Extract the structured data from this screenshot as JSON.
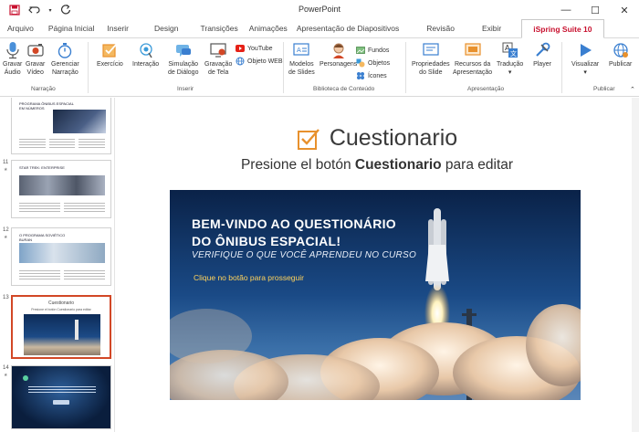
{
  "app": {
    "title": "PowerPoint"
  },
  "window_controls": [
    "—",
    "☐",
    "✕"
  ],
  "tabs": [
    {
      "label": "Arquivo",
      "active": false
    },
    {
      "label": "Página Inicial",
      "active": false
    },
    {
      "label": "Inserir",
      "active": false
    },
    {
      "label": "Design",
      "active": false
    },
    {
      "label": "Transições",
      "active": false
    },
    {
      "label": "Animações",
      "active": false
    },
    {
      "label": "Apresentação de Diapositivos",
      "active": false
    },
    {
      "label": "Revisão",
      "active": false
    },
    {
      "label": "Exibir",
      "active": false
    },
    {
      "label": "iSpring Suite 10",
      "active": true
    }
  ],
  "ribbon": {
    "narration": {
      "group_label": "Narração",
      "buttons": [
        {
          "line1": "Gravar",
          "line2": "Áudio",
          "icon": "microphone-icon"
        },
        {
          "line1": "Gravar",
          "line2": "Vídeo",
          "icon": "camera-icon"
        },
        {
          "line1": "Gerenciar",
          "line2": "Narração",
          "icon": "stopwatch-icon"
        }
      ]
    },
    "insert": {
      "group_label": "Inserir",
      "buttons": [
        {
          "line1": "Exercício",
          "line2": "",
          "icon": "checkbox-icon"
        },
        {
          "line1": "Interação",
          "line2": "",
          "icon": "interaction-icon"
        },
        {
          "line1": "Simulação",
          "line2": "de Diálogo",
          "icon": "dialog-icon"
        },
        {
          "line1": "Gravação",
          "line2": "de Tela",
          "icon": "screen-record-icon"
        }
      ],
      "small": [
        {
          "label": "YouTube",
          "icon": "youtube-icon"
        },
        {
          "label": "Objeto WEB",
          "icon": "globe-icon"
        }
      ]
    },
    "library": {
      "group_label": "Biblioteca de Conteúdo",
      "buttons": [
        {
          "line1": "Modelos",
          "line2": "de Slides",
          "icon": "slide-templates-icon"
        },
        {
          "line1": "Personagens",
          "line2": "",
          "icon": "character-icon"
        }
      ],
      "small": [
        {
          "label": "Fundos",
          "icon": "backgrounds-icon"
        },
        {
          "label": "Objetos",
          "icon": "objects-icon"
        },
        {
          "label": "Ícones",
          "icon": "icons-icon"
        }
      ]
    },
    "presentation": {
      "group_label": "Apresentação",
      "buttons": [
        {
          "line1": "Propriedades",
          "line2": "do Slide",
          "icon": "slide-properties-icon"
        },
        {
          "line1": "Recursos da",
          "line2": "Apresentação",
          "icon": "presentation-resources-icon"
        },
        {
          "line1": "Tradução",
          "line2": "▾",
          "icon": "translate-icon"
        },
        {
          "line1": "Player",
          "line2": "",
          "icon": "player-icon"
        }
      ]
    },
    "publish": {
      "group_label": "Publicar",
      "buttons": [
        {
          "line1": "Visualizar",
          "line2": "▾",
          "icon": "play-icon"
        },
        {
          "line1": "Publicar",
          "line2": "",
          "icon": "publish-globe-icon"
        }
      ]
    }
  },
  "thumbnails": [
    {
      "number": "",
      "title": "PROGRAMA ÔNIBUS ESPACIAL EM NÚMEROS",
      "selected": false
    },
    {
      "number": "11",
      "title": "STAR TREK: ENTERPRISE",
      "selected": false
    },
    {
      "number": "12",
      "title": "O PROGRAMA SOVIÉTICO BURAN",
      "selected": false
    },
    {
      "number": "13",
      "title": "Cuestionario",
      "subtitle": "Presione el botón Cuestionario para editar",
      "selected": true
    },
    {
      "number": "14",
      "title": "",
      "selected": false
    }
  ],
  "main": {
    "quiz_label": "Cuestionario",
    "subtitle_pre": "Presione el botón ",
    "subtitle_bold": "Cuestionario",
    "subtitle_post": " para editar",
    "slide": {
      "heading_line1": "BEM-VINDO AO QUESTIONÁRIO",
      "heading_line2": "DO ÔNIBUS ESPACIAL!",
      "subheading": "VERIFIQUE O QUE VOCÊ APRENDEU NO CURSO",
      "cta": "Clique no botão para prosseguir"
    }
  },
  "colors": {
    "accent_tab": "#c8102e",
    "selected_thumb": "#d24726",
    "quiz_icon": "#e8912d",
    "slide_bg": "#0d2c58",
    "cta_text": "#ffd35c"
  }
}
